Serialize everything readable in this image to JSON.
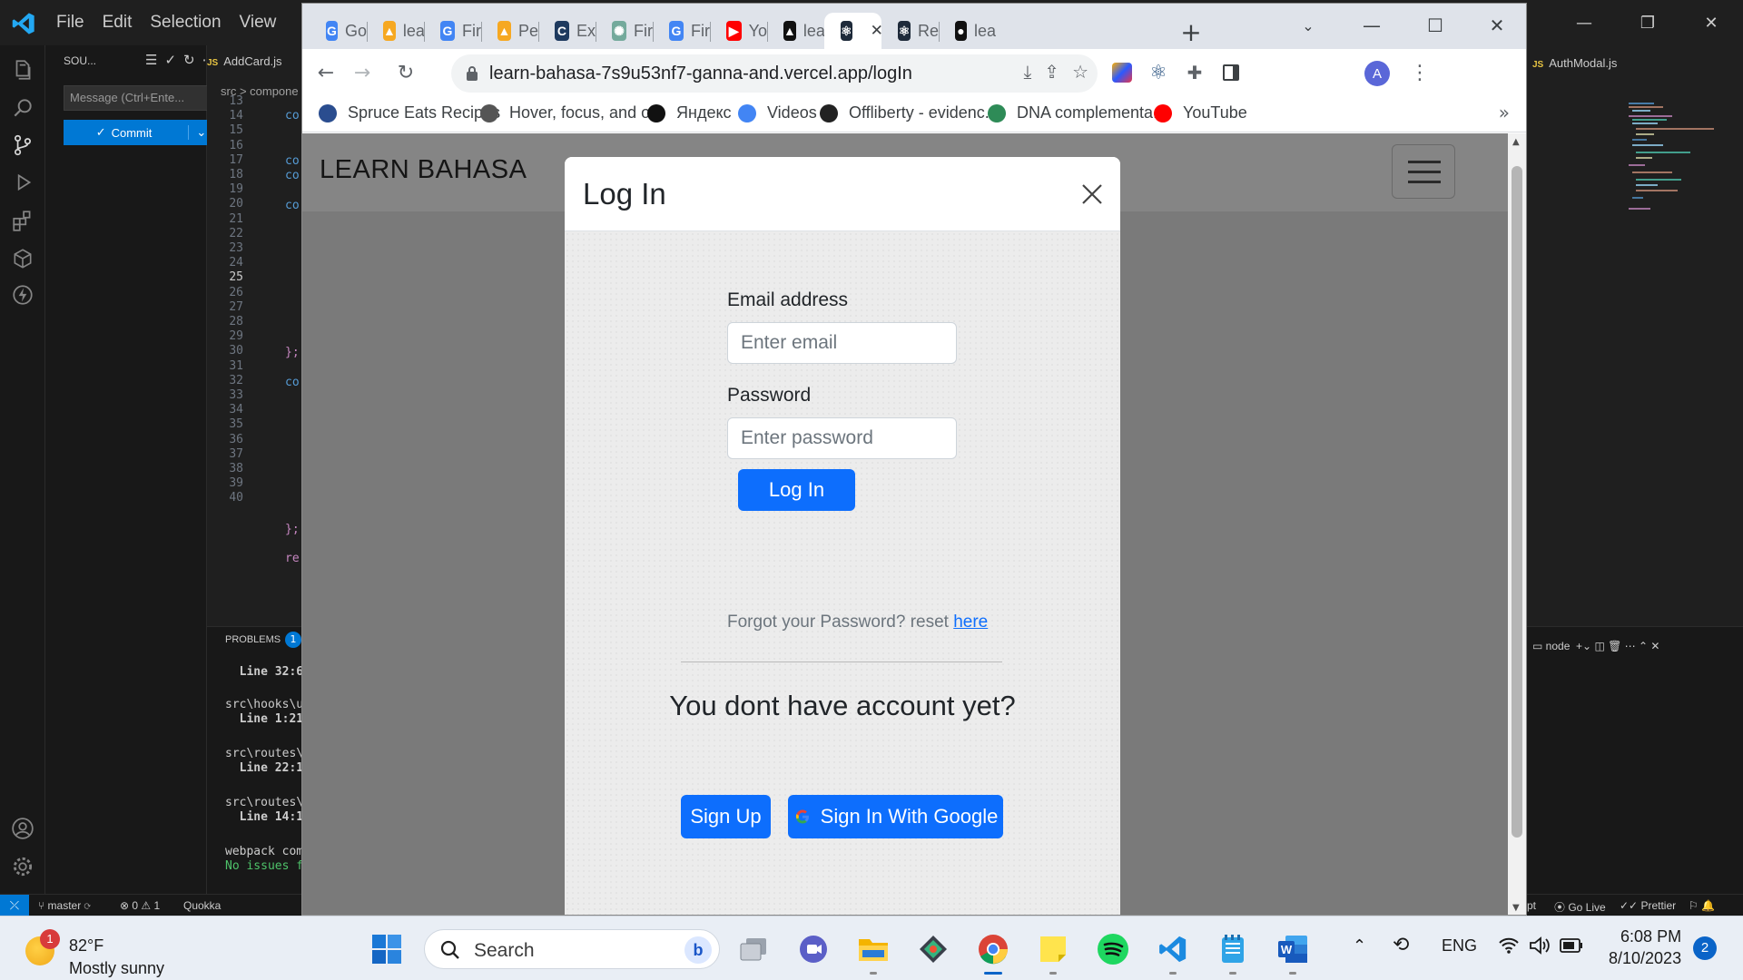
{
  "vscode": {
    "menu": [
      "File",
      "Edit",
      "Selection",
      "View"
    ],
    "sidebar": {
      "title": "SOU...",
      "message_placeholder": "Message (Ctrl+Ente...",
      "commit_label": "Commit"
    },
    "editor_tab": "AddCard.js",
    "breadcrumb": "src > compone",
    "line_numbers": [
      "13",
      "14",
      "15",
      "16",
      "17",
      "18",
      "19",
      "20",
      "21",
      "22",
      "23",
      "24",
      "25",
      "26",
      "27",
      "28",
      "29",
      "30",
      "31",
      "32",
      "33",
      "34",
      "35",
      "36",
      "37",
      "38",
      "39",
      "40"
    ],
    "active_line": "25",
    "code_fragments": {
      "l13": "co",
      "l15": "co",
      "l16": "co",
      "l18": "co",
      "l26": "};",
      "l28": "co",
      "l38": "};",
      "l40": "re"
    },
    "panel": {
      "tab": "PROBLEMS",
      "badge": "1",
      "lines": [
        "  Line 32:6",
        "src\\hooks\\u",
        "  Line 1:21",
        "src\\routes\\",
        "  Line 22:1",
        "src\\routes\\",
        "  Line 14:1",
        "webpack com",
        "No issues f"
      ]
    },
    "right_tab": "AuthModal.js",
    "right_panel_label": "node",
    "status": {
      "branch": "master",
      "problems": "⊗ 0 ⚠ 1",
      "quokka": "Quokka",
      "right1": "pt",
      "golive": "Go Live",
      "prettier": "Prettier"
    }
  },
  "browser": {
    "tabs": [
      {
        "label": "Go",
        "icon": "google-translate-icon",
        "color": "#4285f4",
        "glyph": "G"
      },
      {
        "label": "lea",
        "icon": "firebase-icon",
        "color": "#f6a821",
        "glyph": "▲"
      },
      {
        "label": "Fir",
        "icon": "google-icon",
        "color": "#4285f4",
        "glyph": "G"
      },
      {
        "label": "Pe",
        "icon": "firebase-icon",
        "color": "#f6a821",
        "glyph": "▲"
      },
      {
        "label": "Ex",
        "icon": "codepen-icon",
        "color": "#1e3a5f",
        "glyph": "C"
      },
      {
        "label": "Fir",
        "icon": "chatgpt-icon",
        "color": "#74aa9c",
        "glyph": "✺"
      },
      {
        "label": "Fir",
        "icon": "google-icon",
        "color": "#4285f4",
        "glyph": "G"
      },
      {
        "label": "Yo",
        "icon": "youtube-icon",
        "color": "#ff0000",
        "glyph": "▶"
      },
      {
        "label": "lea",
        "icon": "vercel-icon",
        "color": "#111111",
        "glyph": "▲"
      },
      {
        "label": "",
        "icon": "react-icon",
        "color": "#1e2a3a",
        "glyph": "⚛"
      },
      {
        "label": "Re",
        "icon": "react-icon",
        "color": "#1e2a3a",
        "glyph": "⚛"
      },
      {
        "label": "lea",
        "icon": "github-icon",
        "color": "#111111",
        "glyph": "●"
      }
    ],
    "url": "learn-bahasa-7s9u53nf7-ganna-and.vercel.app/logIn",
    "profile_initial": "A",
    "bookmarks": [
      {
        "label": "Spruce Eats Recipes",
        "icon": "spruce-eats-icon",
        "color": "#2a4d8f"
      },
      {
        "label": "Hover, focus, and o...",
        "icon": "globe-icon",
        "color": "#555555"
      },
      {
        "label": "Яндекс",
        "icon": "yandex-icon",
        "color": "#111111"
      },
      {
        "label": "Videos",
        "icon": "google-icon",
        "color": "#4285f4"
      },
      {
        "label": "Offliberty - evidenc...",
        "icon": "power-icon",
        "color": "#222222"
      },
      {
        "label": "DNA complementa...",
        "icon": "dna-icon",
        "color": "#2e8b57"
      },
      {
        "label": "YouTube",
        "icon": "youtube-icon",
        "color": "#ff0000"
      }
    ]
  },
  "page": {
    "brand": "LEARN BAHASA",
    "modal": {
      "title": "Log In",
      "email_label": "Email address",
      "email_placeholder": "Enter email",
      "password_label": "Password",
      "password_placeholder": "Enter password",
      "login_button": "Log In",
      "forgot_text": "Forgot your Password? reset ",
      "forgot_link": "here",
      "no_account_heading": "You dont have account yet?",
      "signup_button": "Sign Up",
      "google_button": "Sign In With Google"
    },
    "colors": {
      "primary": "#0d6efd",
      "backdrop": "#7a7a7a"
    }
  },
  "taskbar": {
    "weather_badge": "1",
    "temperature": "82°F",
    "condition": "Mostly sunny",
    "search_label": "Search",
    "language": "ENG",
    "time": "6:08 PM",
    "date": "8/10/2023",
    "notification_count": "2"
  }
}
